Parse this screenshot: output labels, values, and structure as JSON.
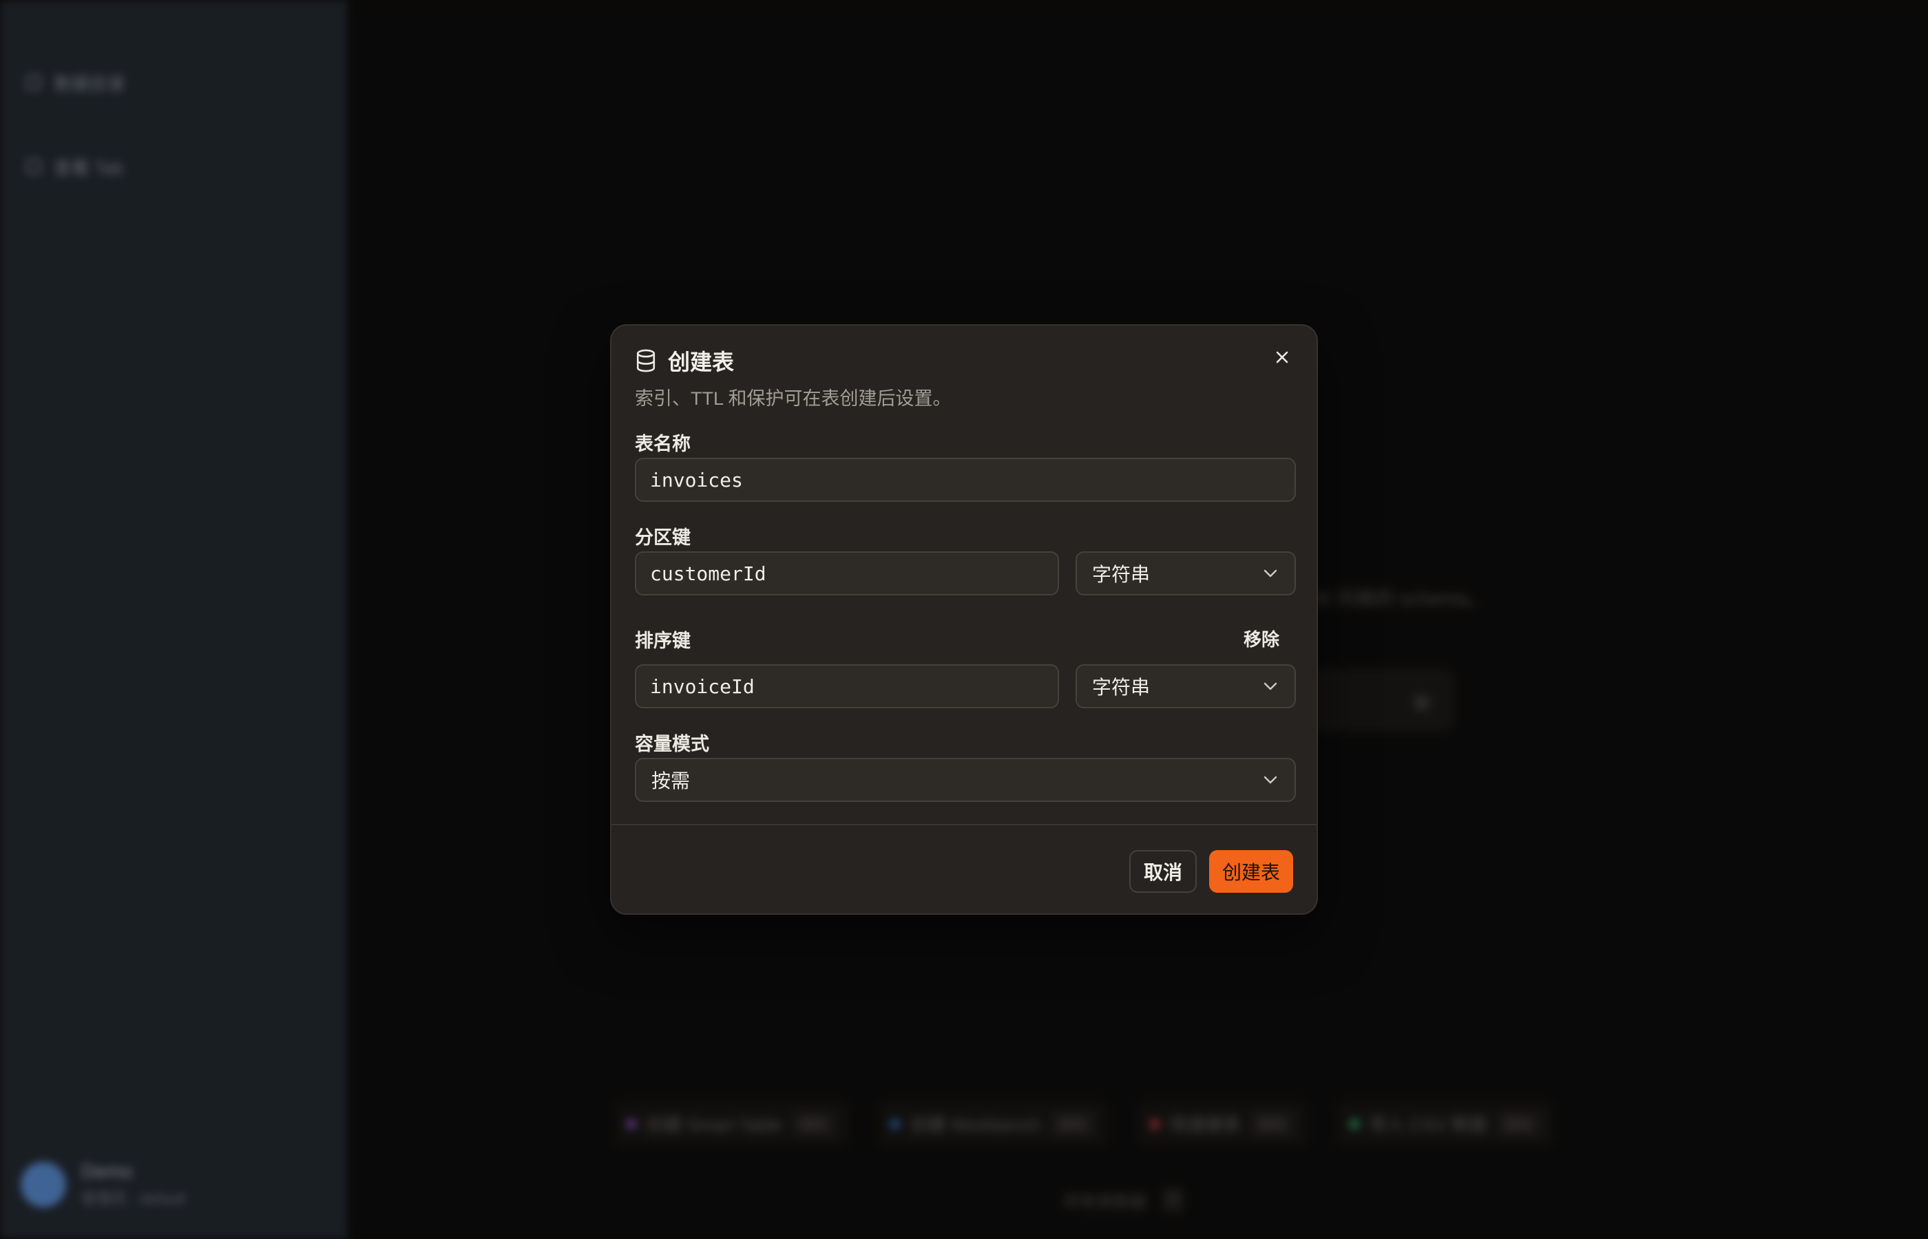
{
  "background": {
    "sidebar": {
      "items": [
        {
          "label": "数据目录"
        },
        {
          "label": "查看 Tab"
        }
      ],
      "user": {
        "name": "Demo",
        "sub": "管理员 · default"
      }
    },
    "hint_text": "点击以创建您的第一张表，支持 DynamoDB 风格的 schema。",
    "box_label": "新",
    "chips": [
      {
        "label": "创建 Smart Table",
        "tag": "模板",
        "color": "#9b59d6"
      },
      {
        "label": "创建 Workbench",
        "tag": "模板",
        "color": "#3a7bd5"
      },
      {
        "label": "快速建表",
        "tag": "模板",
        "color": "#d64545"
      },
      {
        "label": "导入 CSV 数据",
        "tag": "模板",
        "color": "#38b26f"
      }
    ],
    "footer": {
      "text": "所有表数据",
      "tag": "0"
    }
  },
  "dialog": {
    "title": "创建表",
    "icon": "database-icon",
    "subtitle": "索引、TTL 和保护可在表创建后设置。",
    "table_name": {
      "label": "表名称",
      "value": "invoices"
    },
    "partition_key": {
      "label": "分区键",
      "value": "customerId",
      "type": "字符串"
    },
    "sort_key": {
      "label": "排序键",
      "value": "invoiceId",
      "type": "字符串",
      "remove_label": "移除"
    },
    "capacity_mode": {
      "label": "容量模式",
      "value": "按需"
    },
    "cancel_label": "取消",
    "create_label": "创建表",
    "accent": "#f26419"
  }
}
